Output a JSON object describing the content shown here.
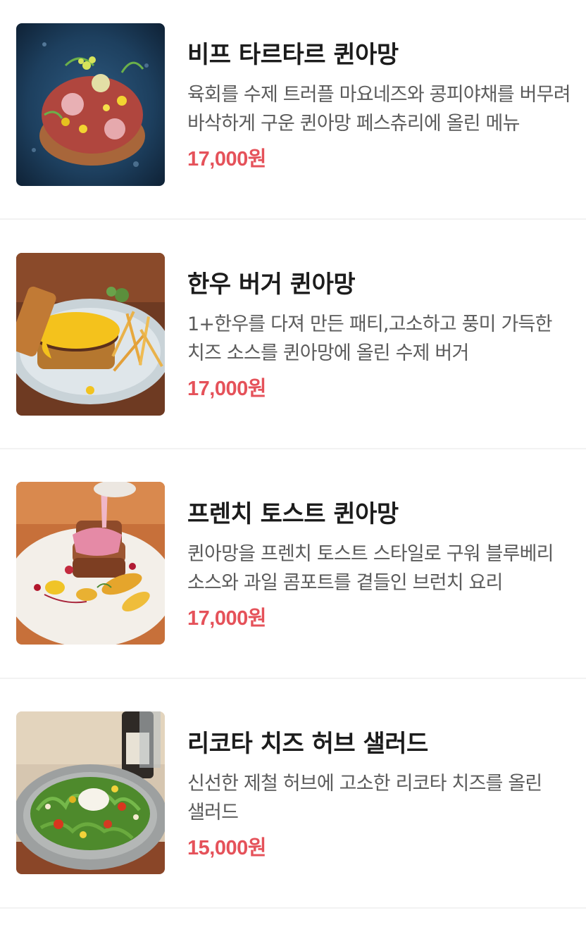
{
  "menu": {
    "items": [
      {
        "name": "비프 타르타르 퀸아망",
        "description": "육회를 수제 트러플 마요네즈와 콩피야채를 버무려 바삭하게 구운 퀸아망 페스츄리에 올린 메뉴",
        "price": "17,000원",
        "image_icon": "beef-tartare-dish-photo"
      },
      {
        "name": "한우 버거 퀸아망",
        "description": "1+한우를 다져 만든 패티,고소하고 풍미 가득한 치즈 소스를 퀸아망에 올린 수제 버거",
        "price": "17,000원",
        "image_icon": "hanwoo-burger-dish-photo"
      },
      {
        "name": "프렌치 토스트 퀸아망",
        "description": "퀸아망을 프렌치 토스트 스타일로 구워 블루베리 소스와 과일 콤포트를 곁들인 브런치 요리",
        "price": "17,000원",
        "image_icon": "french-toast-dish-photo"
      },
      {
        "name": "리코타 치즈 허브 샐러드",
        "description": "신선한 제철 허브에 고소한 리코타 치즈를 올린 샐러드",
        "price": "15,000원",
        "image_icon": "ricotta-salad-dish-photo"
      }
    ]
  },
  "colors": {
    "price": "#e5525a",
    "title": "#1c1c1c",
    "description": "#5b5b5b",
    "divider": "#f2f2f2"
  }
}
